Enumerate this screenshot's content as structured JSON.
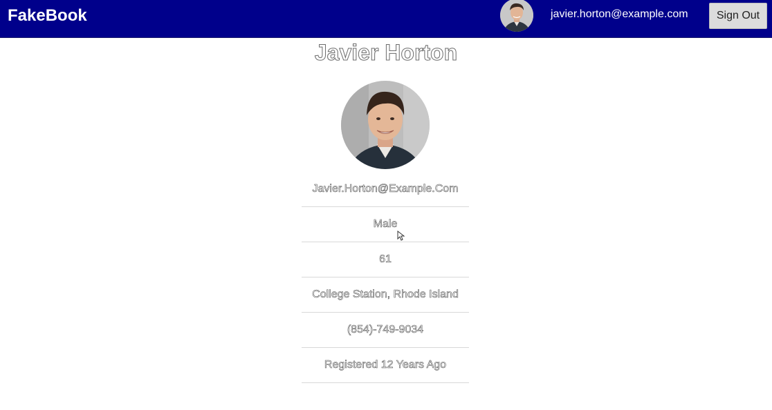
{
  "header": {
    "brand": "FakeBook",
    "user_email": "javier.horton@example.com",
    "signout_label": "Sign Out",
    "background_color": "#00008b"
  },
  "profile": {
    "name": "Javier Horton",
    "email": "Javier.Horton@Example.Com",
    "gender": "Male",
    "age": "61",
    "location": "College Station, Rhode Island",
    "phone": "(854)-749-9034",
    "registered": "Registered 12 Years Ago"
  },
  "icons": {
    "header_avatar": "avatar-photo",
    "profile_photo": "profile-photo",
    "cursor": "mouse-pointer-icon"
  }
}
